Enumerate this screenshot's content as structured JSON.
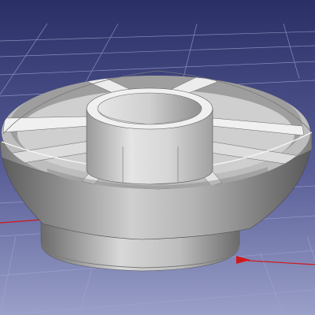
{
  "viewport": {
    "background_top": "#2a2f66",
    "background_bottom": "#9aa0c8",
    "grid_color": "#a2a6d2",
    "axis_x_color": "#d01818",
    "model_light": "#f2f2f2",
    "model_mid": "#c4c4c4",
    "model_dark": "#6e6e6e",
    "model_shadow": "#3e3e3e"
  },
  "model": {
    "name": "funnel-hub-with-radial-ribs",
    "rib_count": 8
  }
}
